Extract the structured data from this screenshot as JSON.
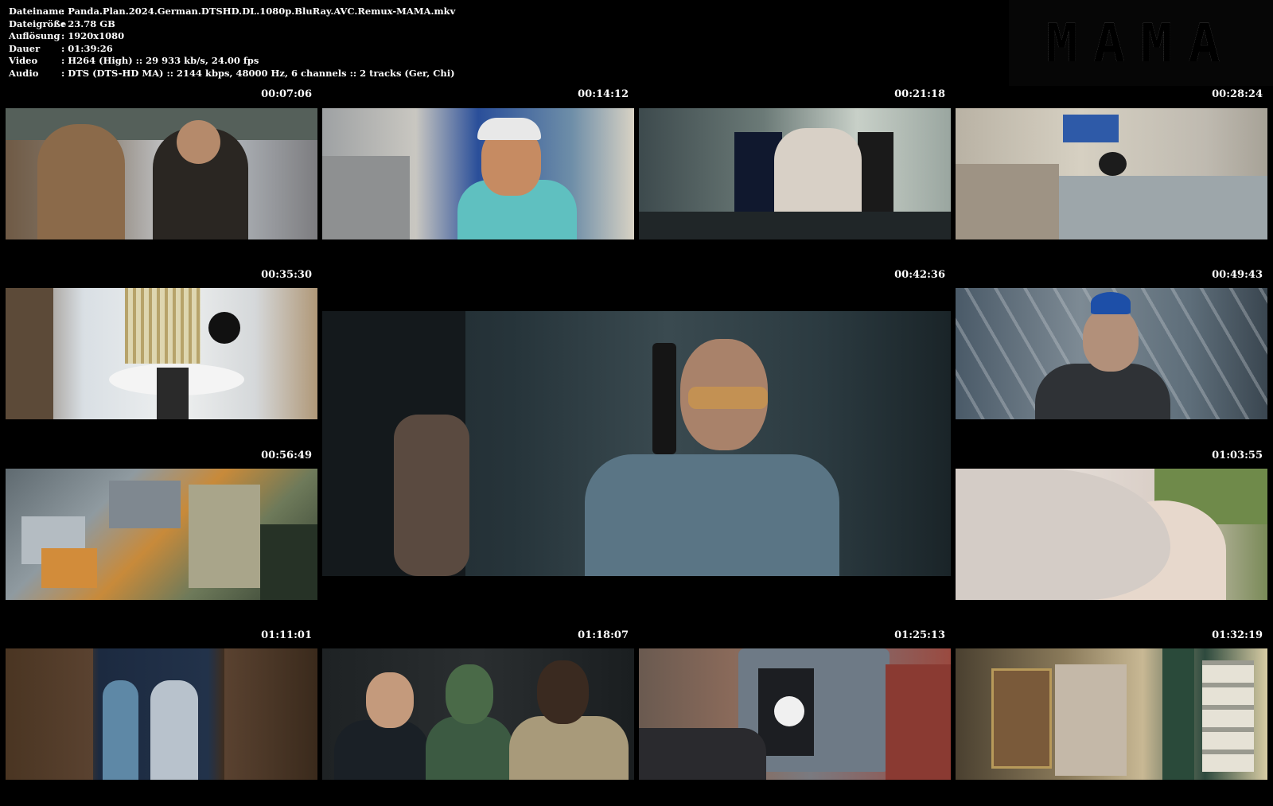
{
  "info": {
    "rows": [
      {
        "label": "Dateiname",
        "value": "Panda.Plan.2024.German.DTSHD.DL.1080p.BluRay.AVC.Remux-MAMA.mkv"
      },
      {
        "label": "Dateigröße",
        "value": "23.78 GB"
      },
      {
        "label": "Auflösung",
        "value": "1920x1080"
      },
      {
        "label": "Dauer",
        "value": "01:39:26"
      },
      {
        "label": "Video",
        "value": "H264 (High) :: 29 933 kb/s, 24.00 fps"
      },
      {
        "label": "Audio",
        "value": "DTS (DTS-HD MA) :: 2144 kbps, 48000 Hz, 6 channels :: 2 tracks (Ger, Chi)"
      }
    ]
  },
  "logo": {
    "text": "MAMA"
  },
  "timestamps": [
    "00:07:06",
    "00:14:12",
    "00:21:18",
    "00:28:24",
    "00:35:30",
    "00:42:36",
    "00:49:43",
    "00:56:49",
    "01:03:55",
    "01:11:01",
    "01:18:07",
    "01:25:13",
    "01:32:19"
  ]
}
